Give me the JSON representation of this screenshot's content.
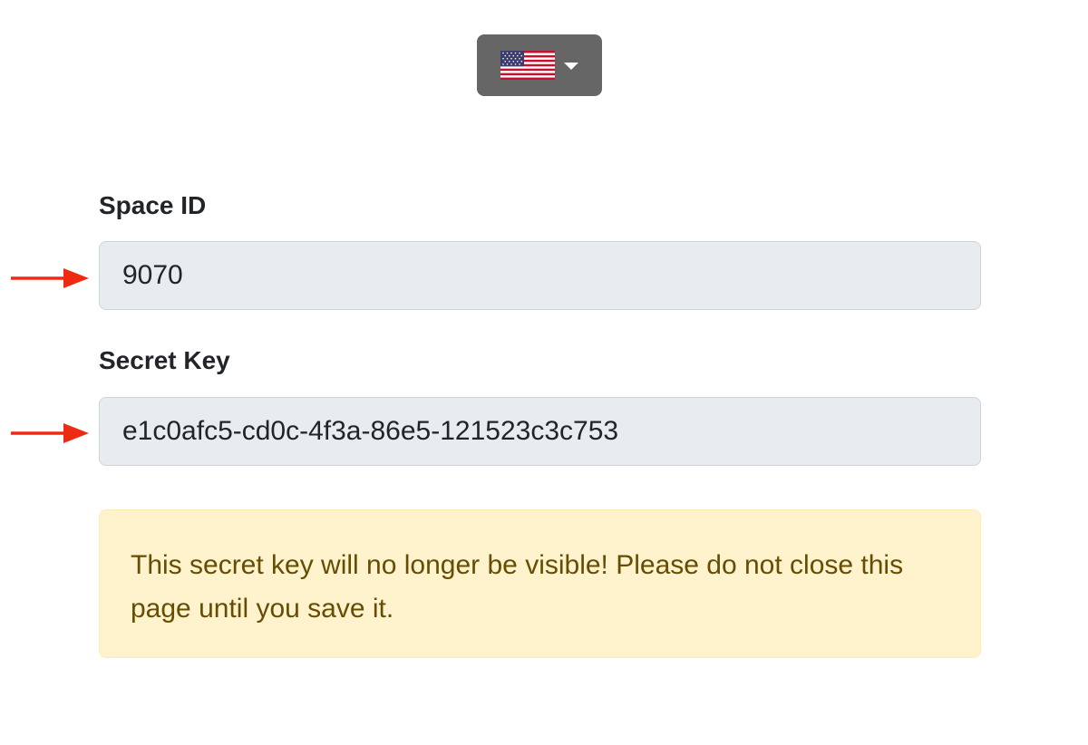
{
  "language_selector": {
    "current": "United States flag",
    "icon": "us-flag-icon"
  },
  "form": {
    "space_id": {
      "label": "Space ID",
      "value": "9070"
    },
    "secret_key": {
      "label": "Secret Key",
      "value": "e1c0afc5-cd0c-4f3a-86e5-121523c3c753"
    }
  },
  "alert": {
    "message": "This secret key will no longer be visible! Please do not close this page until you save it."
  },
  "colors": {
    "annotation_arrow": "#ee2a12",
    "alert_background": "#fff3cd",
    "alert_text": "#664d03",
    "button_background": "#666666",
    "input_background": "#e9ecef"
  }
}
